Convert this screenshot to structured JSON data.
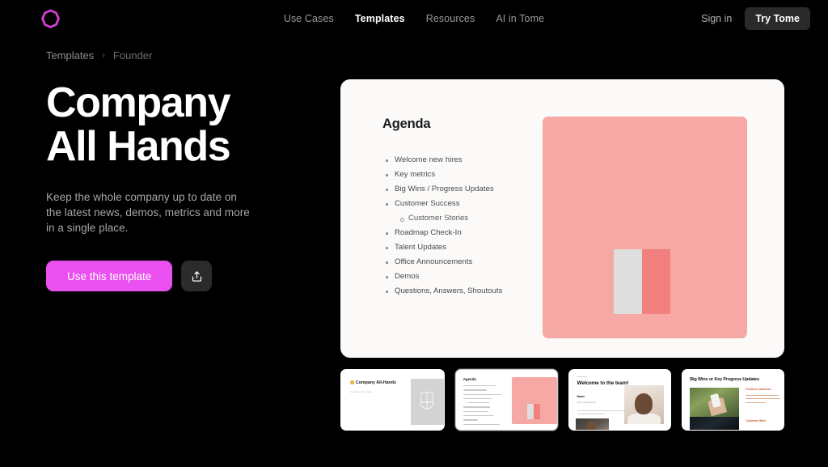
{
  "nav": {
    "logo_name": "tome-logo",
    "logo_color": "#d43fd4",
    "links": [
      {
        "label": "Use Cases",
        "active": false
      },
      {
        "label": "Templates",
        "active": true
      },
      {
        "label": "Resources",
        "active": false
      },
      {
        "label": "AI in Tome",
        "active": false
      }
    ],
    "signin_label": "Sign in",
    "try_label": "Try Tome"
  },
  "breadcrumb": {
    "parent": "Templates",
    "separator": "›",
    "current": "Founder"
  },
  "hero": {
    "title": "Company All Hands",
    "description": "Keep the whole company up to date on the latest news, demos, metrics and more in a single place.",
    "primary_button": "Use this template",
    "primary_button_color": "#ea4ff0",
    "share_icon": "share-icon"
  },
  "slide": {
    "title": "Agenda",
    "background": "#fbfaf9",
    "bullets": [
      {
        "text": "Welcome new hires",
        "level": 1
      },
      {
        "text": "Key metrics",
        "level": 1
      },
      {
        "text": "Big Wins / Progress Updates",
        "level": 1
      },
      {
        "text": "Customer Success",
        "level": 1
      },
      {
        "text": "Customer Stories",
        "level": 2
      },
      {
        "text": "Roadmap Check-In",
        "level": 1
      },
      {
        "text": "Talent Updates",
        "level": 1
      },
      {
        "text": "Office Announcements",
        "level": 1
      },
      {
        "text": "Demos",
        "level": 1
      },
      {
        "text": "Questions, Answers, Shoutouts",
        "level": 1
      }
    ],
    "figure": {
      "fill": "#f5a8a4",
      "bar_light": "#dddedd",
      "bar_dark": "#f2807e"
    }
  },
  "thumbnails": [
    {
      "name": "thumbnail-title-slide",
      "title": "Company All-Hands",
      "subtitle": "Company Day, Date",
      "selected": false
    },
    {
      "name": "thumbnail-agenda-slide",
      "title": "Agenda",
      "selected": true
    },
    {
      "name": "thumbnail-welcome-slide",
      "title": "Welcome to the team!",
      "name_label": "Name",
      "role_label": "Role, Department",
      "selected": false
    },
    {
      "name": "thumbnail-big-wins-slide",
      "title": "Big Wins or Key Progress Updates",
      "subtitle": "Product Launches",
      "subtitle2": "Customer Wins",
      "selected": false
    }
  ]
}
